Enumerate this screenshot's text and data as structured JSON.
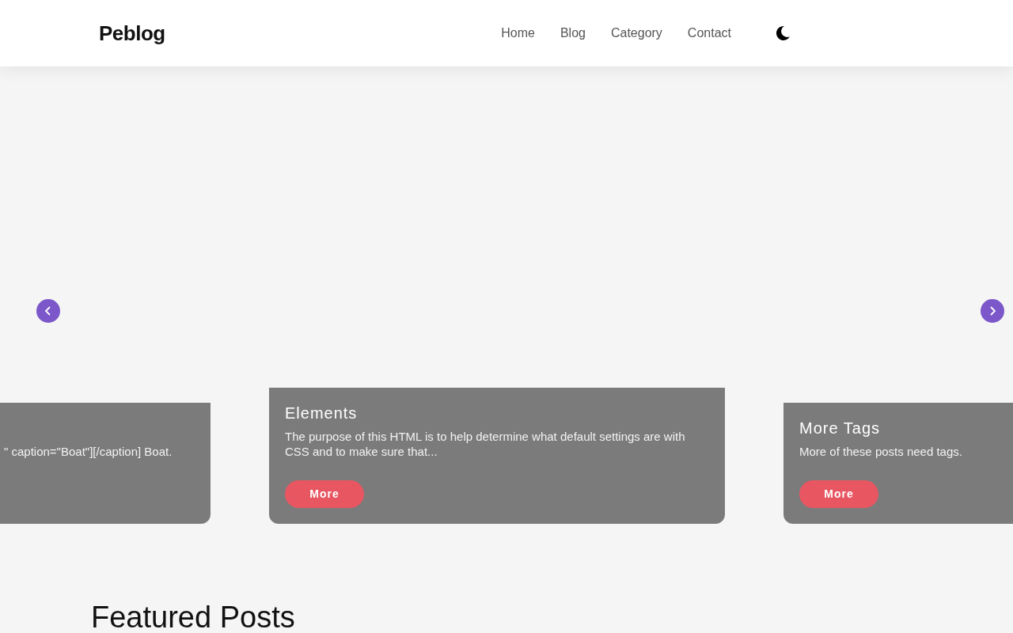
{
  "brand": "Peblog",
  "nav": [
    {
      "label": "Home"
    },
    {
      "label": "Blog"
    },
    {
      "label": "Category"
    },
    {
      "label": "Contact"
    }
  ],
  "dark_mode": false,
  "slides": [
    {
      "kind": "side",
      "excerpt": "\" caption=\"Boat\"][/caption] Boat."
    },
    {
      "kind": "center",
      "title": "Elements",
      "excerpt": "The purpose of this HTML is to help determine what default settings are with CSS and to make sure that...",
      "button": "More"
    },
    {
      "kind": "side",
      "title": "More Tags",
      "excerpt": "More of these posts need tags.",
      "button": "More"
    }
  ],
  "featured_heading": "Featured Posts"
}
